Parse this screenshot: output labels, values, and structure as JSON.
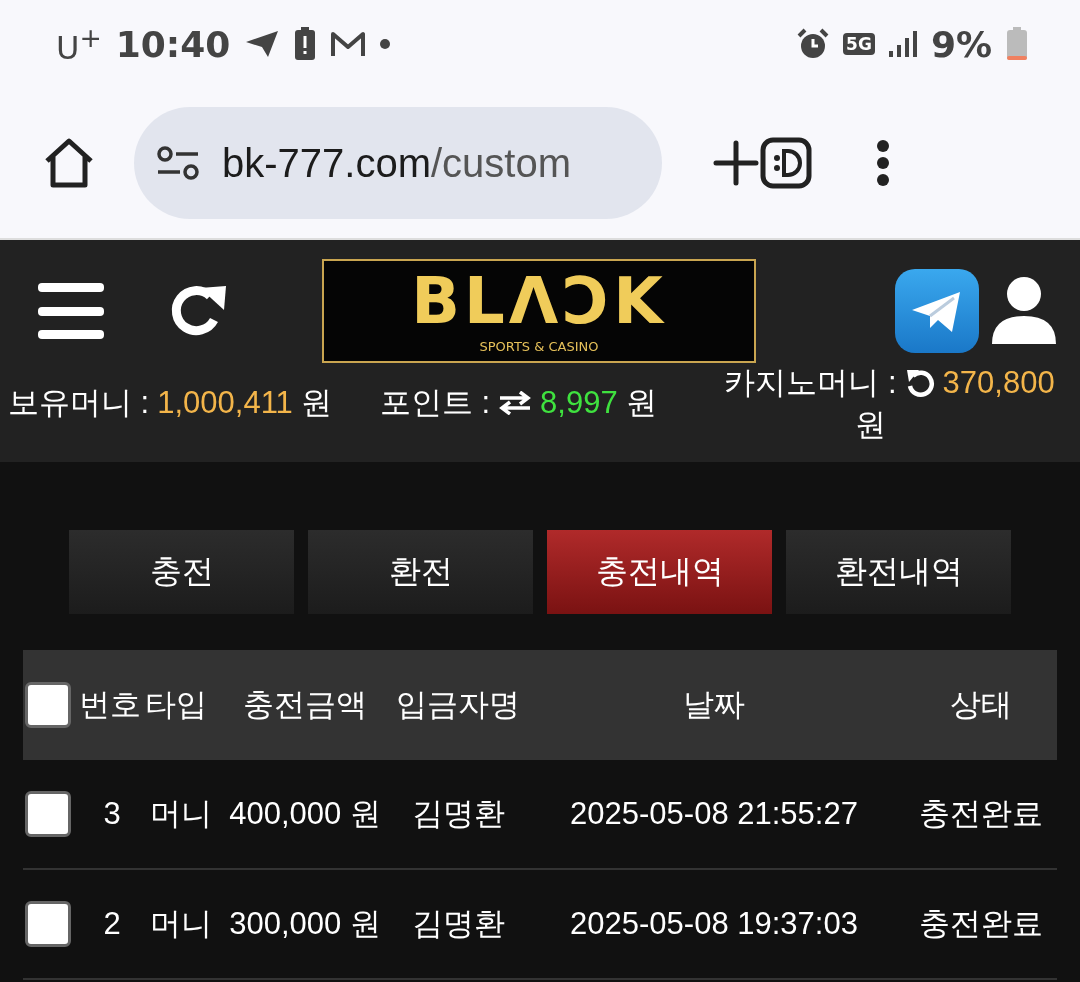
{
  "status_bar": {
    "carrier": "U$^{+}$",
    "time": "10:40",
    "network": "5G",
    "battery": "9%"
  },
  "browser": {
    "url_host": "bk-777.com",
    "url_path": "/custom"
  },
  "site_header": {
    "logo": "BLΛƆK",
    "logo_tagline": "SPORTS & CASINO"
  },
  "balances": [
    {
      "label": "보유머니 :",
      "value": "1,000,411",
      "unit": "원",
      "kind": "money"
    },
    {
      "label": "포인트 :",
      "value": "8,997",
      "unit": "원",
      "kind": "point"
    },
    {
      "label": "카지노머니 :",
      "value": "370,800",
      "unit": "원",
      "kind": "casino"
    }
  ],
  "tabs": [
    {
      "label": "충전",
      "selected": false
    },
    {
      "label": "환전",
      "selected": false
    },
    {
      "label": "충전내역",
      "selected": true
    },
    {
      "label": "환전내역",
      "selected": false
    }
  ],
  "table": {
    "select_all_checked": false,
    "columns": [
      "번호",
      "타입",
      "충전금액",
      "입금자명",
      "날짜",
      "상태"
    ],
    "rows": [
      {
        "checked": false,
        "cells": [
          "3",
          "머니",
          "400,000 원",
          "김명환",
          "2025-05-08 21:55:27",
          "충전완료"
        ]
      },
      {
        "checked": false,
        "cells": [
          "2",
          "머니",
          "300,000 원",
          "김명환",
          "2025-05-08 19:37:03",
          "충전완료"
        ]
      }
    ]
  }
}
